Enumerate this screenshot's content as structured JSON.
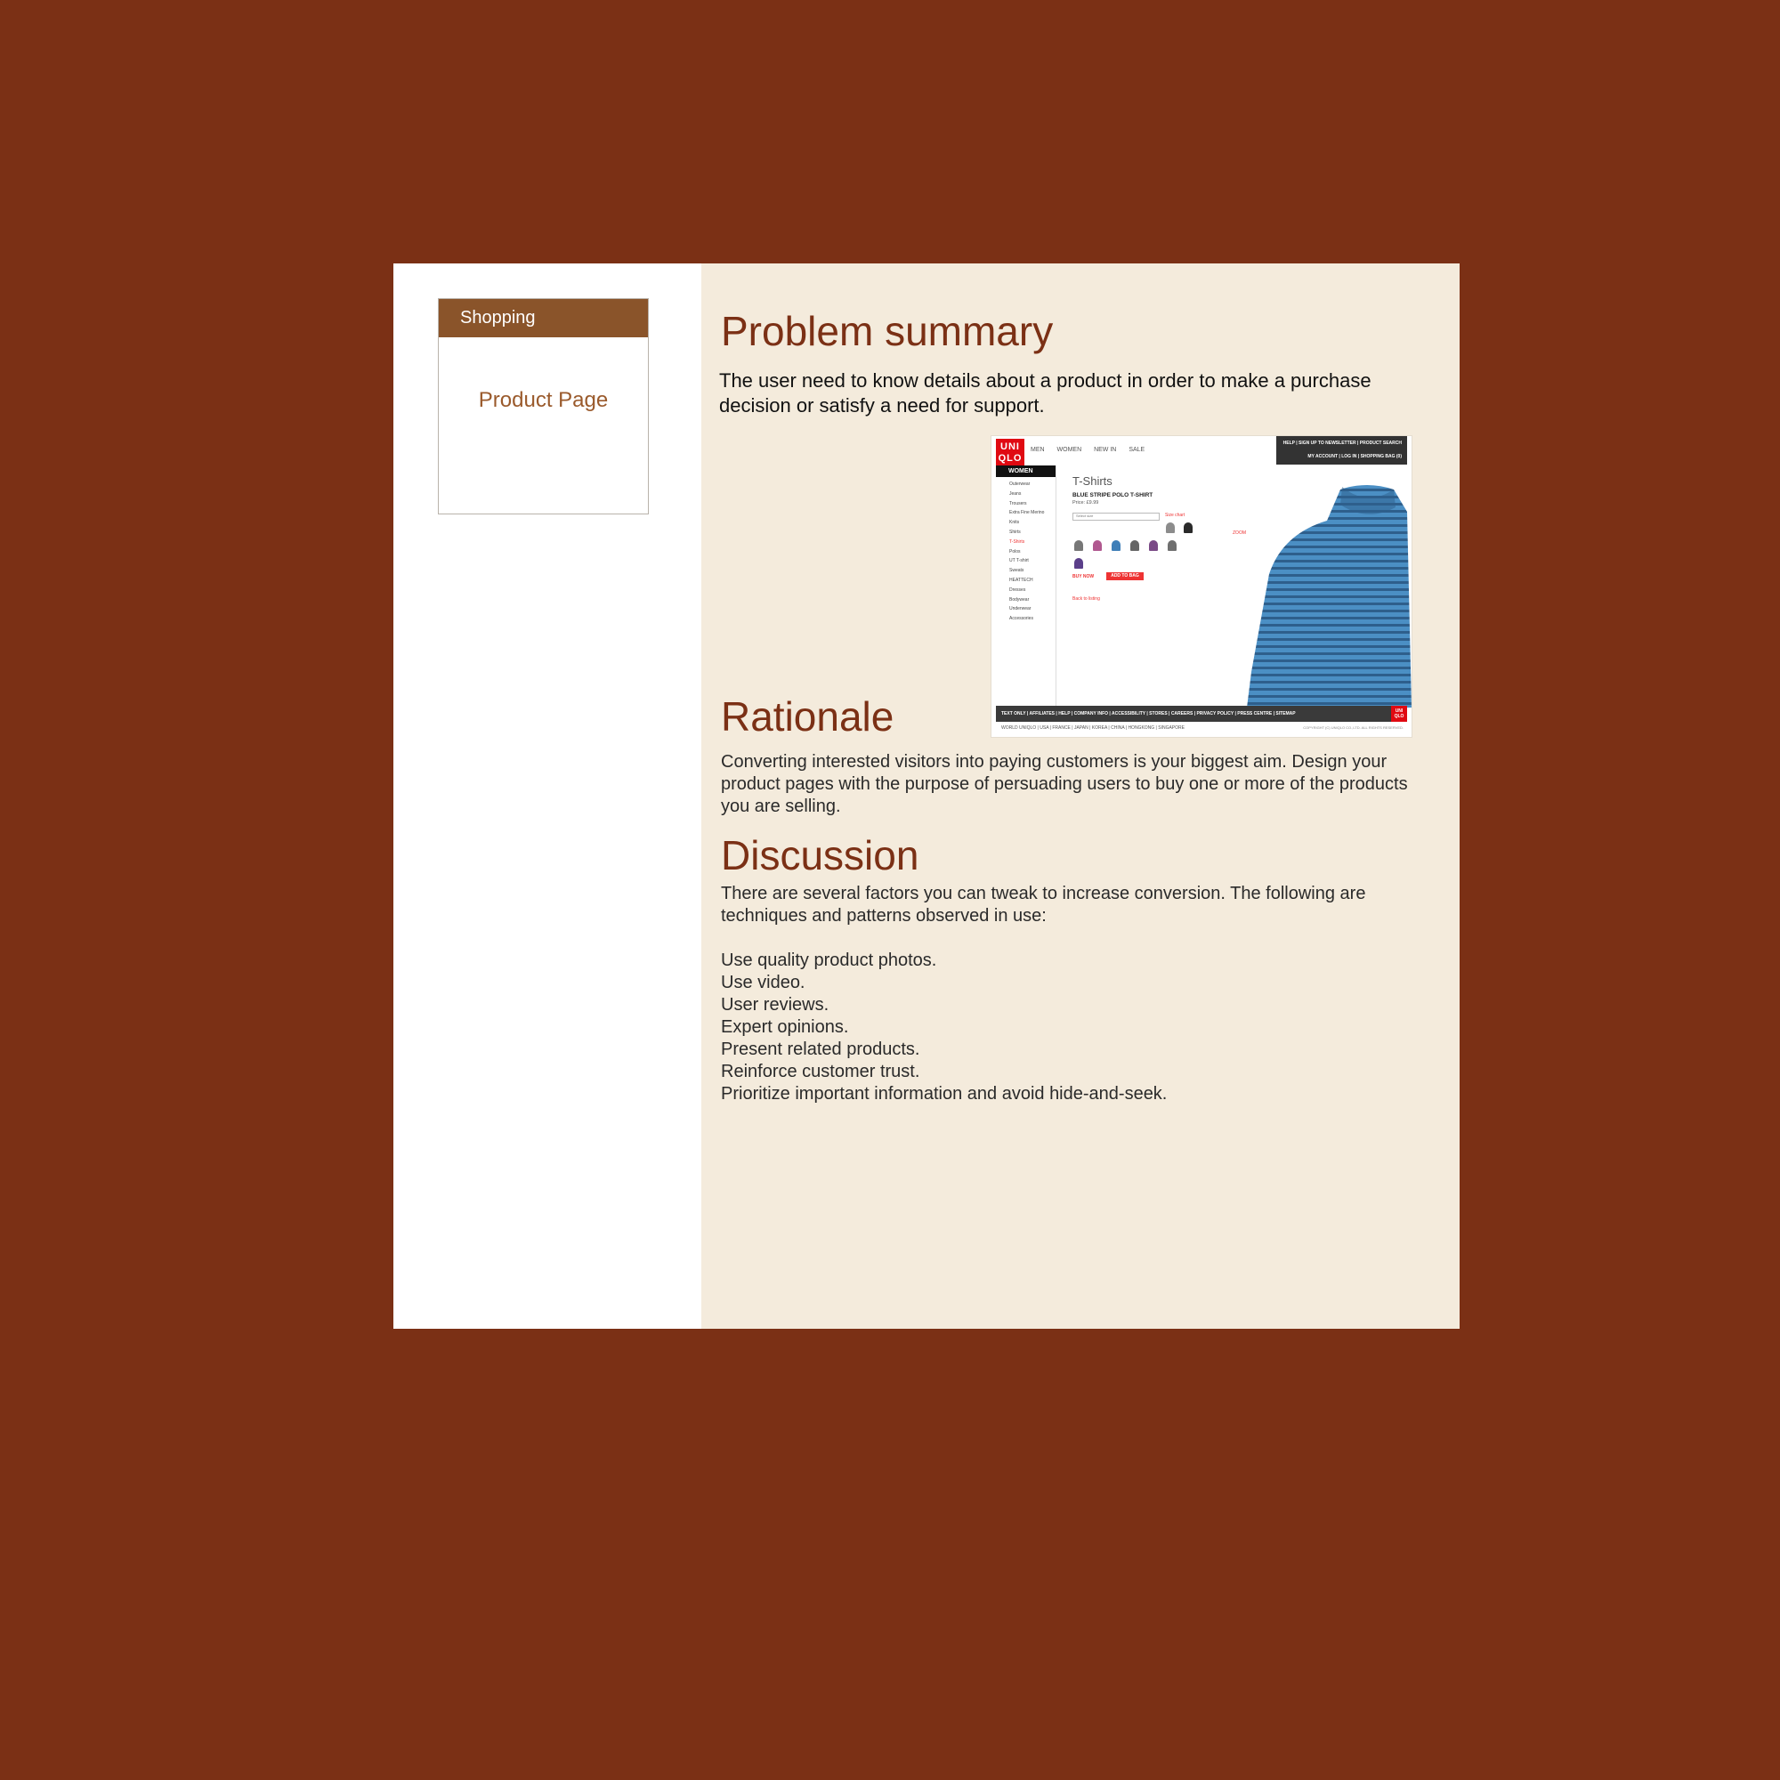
{
  "sidebar": {
    "category": "Shopping",
    "items": [
      {
        "label": "Product Page"
      }
    ]
  },
  "main": {
    "problem": {
      "heading": "Problem summary",
      "text": "The user need to know details about a product in order to make a purchase decision or satisfy a need for support."
    },
    "rationale": {
      "heading": "Rationale",
      "text": "Converting interested visitors into paying customers is your biggest aim. Design your product pages with the purpose of persuading users to buy one or more of the products you are selling."
    },
    "discussion": {
      "heading": "Discussion",
      "text": "There are several factors you can tweak to increase conversion. The following are techniques and patterns observed in use:",
      "list": [
        "Use quality product photos.",
        "Use video.",
        "User reviews.",
        "Expert opinions.",
        "Present related products.",
        "Reinforce customer trust.",
        "Prioritize important information and avoid hide-and-seek."
      ]
    }
  },
  "screenshot": {
    "logo_line1": "UNI",
    "logo_line2": "QLO",
    "nav": [
      "MEN",
      "WOMEN",
      "NEW IN",
      "SALE"
    ],
    "util_top": "HELP  |  SIGN UP TO NEWSLETTER  |  PRODUCT SEARCH",
    "util_bottom": "MY ACCOUNT  |  LOG IN  |  SHOPPING BAG (0)",
    "left_header": "WOMEN",
    "left_items": [
      "Outerwear",
      "Jeans",
      "Trousers",
      "Extra Fine Merino",
      "Knits",
      "Shirts",
      "T-Shirts",
      "Polos",
      "UT T-shirt",
      "Sweats",
      "HEATTECH",
      "Dresses",
      "Bodywear",
      "Underwear",
      "Accessories"
    ],
    "page_title": "T-Shirts",
    "product_name": "BLUE STRIPE POLO T-SHIRT",
    "price": "Price: £9.99",
    "select_placeholder": "Select size",
    "size_chart": "Size chart",
    "zoom": "ZOOM",
    "buy_now": "BUY NOW",
    "add_to_bag": "ADD TO BAG",
    "back": "Back to listing",
    "footer": "TEXT ONLY  |  AFFILIATES  |  HELP  |  COMPANY INFO  |  ACCESSIBILITY  |  STORES  |  CAREERS  |  PRIVACY POLICY  |  PRESS CENTRE  |  SITEMAP",
    "bottom": "WORLD UNIQLO  |  USA  |  FRANCE  |  JAPAN  |  KOREA  |  CHINA  |  HONGKONG  |  SINGAPORE",
    "copyright": "COPYRIGHT (C) UNIQLO CO.,LTD. ALL RIGHTS RESERVED.",
    "swatch_colors": [
      "#8c8c8c",
      "#2a2a2a",
      "#777777",
      "#b0588f",
      "#3f7fb8",
      "#666666",
      "#7a4a86",
      "#6f6f6f",
      "#5b3f8a"
    ]
  },
  "colors": {
    "background": "#7b3015",
    "content_bg": "#f4ebdc",
    "heading": "#7b3015",
    "category_header": "#8a542a",
    "link": "#9a5a2c"
  }
}
